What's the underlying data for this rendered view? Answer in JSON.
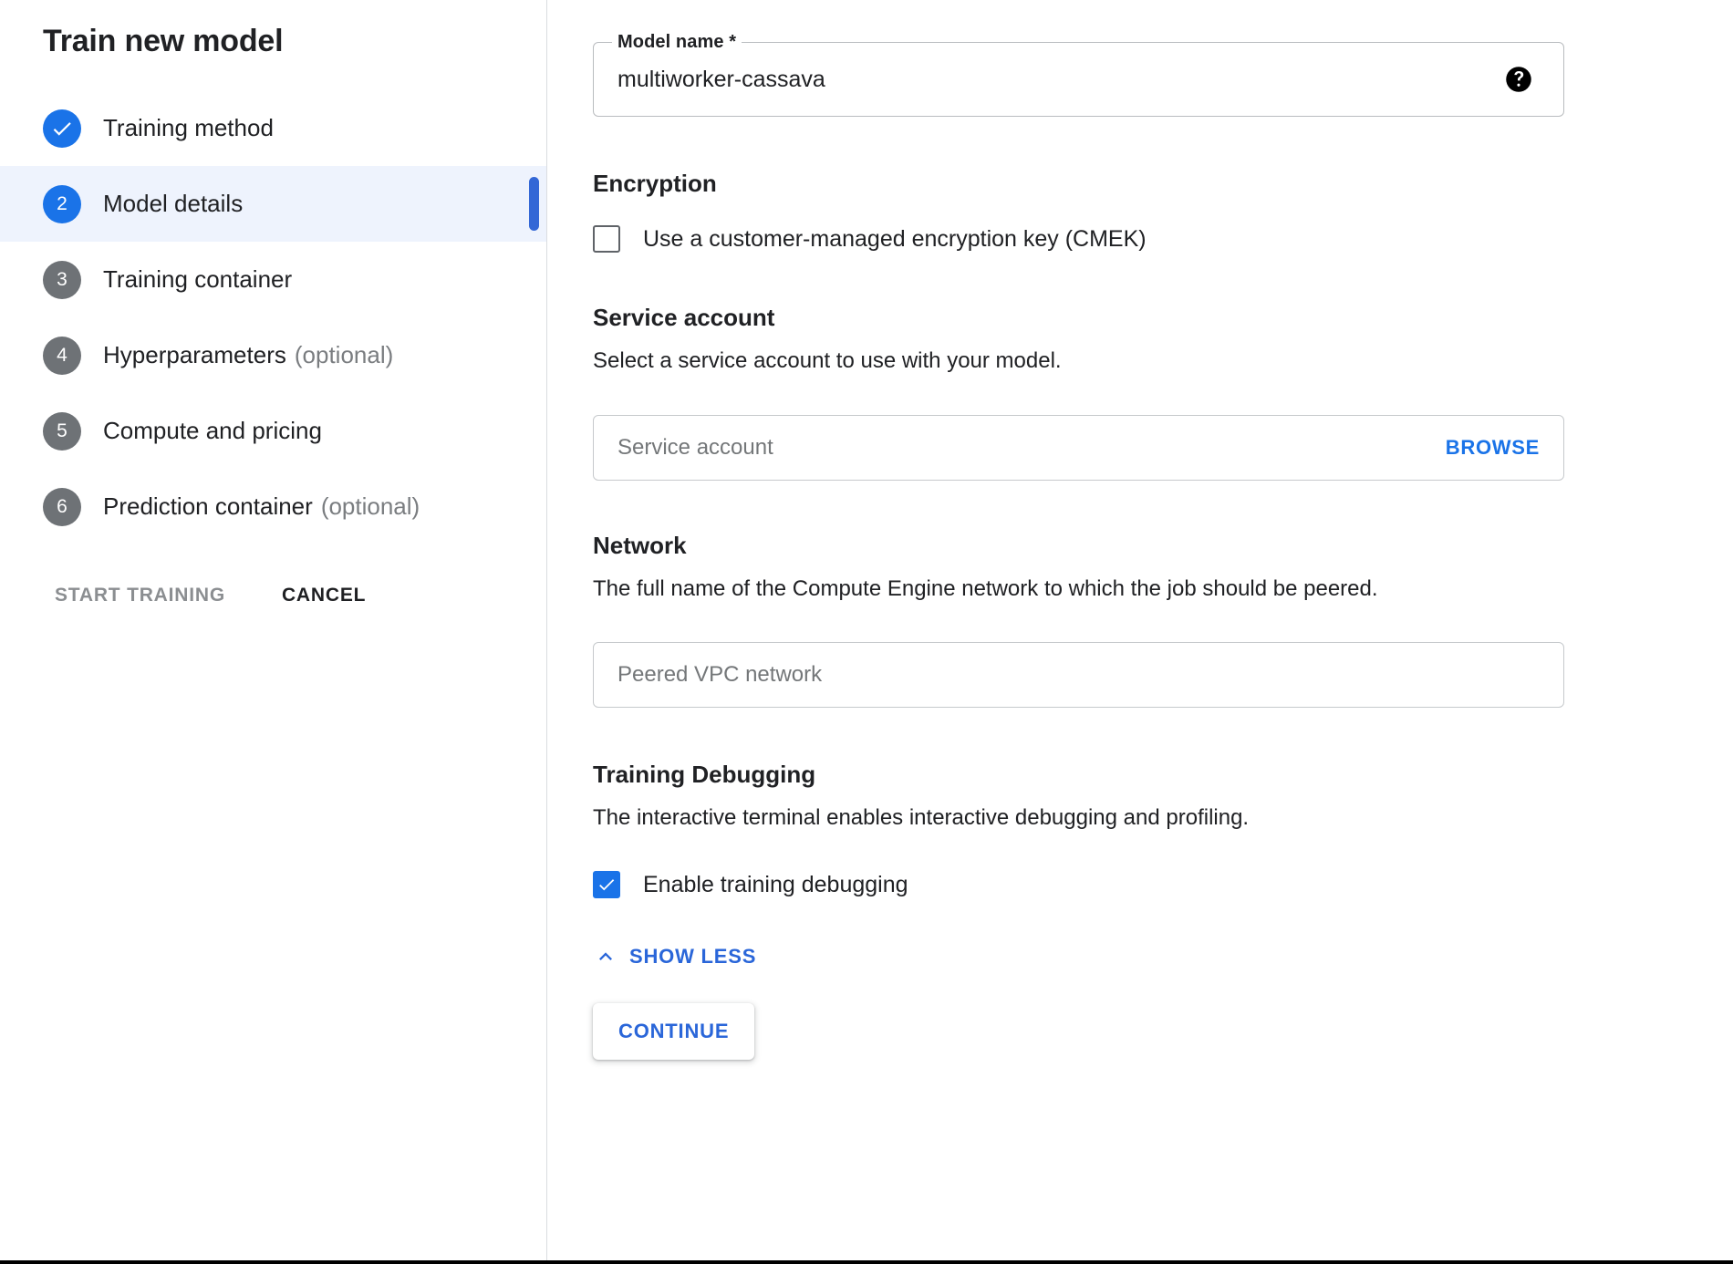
{
  "sidebar": {
    "title": "Train new model",
    "steps": [
      {
        "num": "1",
        "label": "Training method",
        "optional": "",
        "state": "done"
      },
      {
        "num": "2",
        "label": "Model details",
        "optional": "",
        "state": "current"
      },
      {
        "num": "3",
        "label": "Training container",
        "optional": "",
        "state": "pending"
      },
      {
        "num": "4",
        "label": "Hyperparameters",
        "optional": "(optional)",
        "state": "pending"
      },
      {
        "num": "5",
        "label": "Compute and pricing",
        "optional": "",
        "state": "pending"
      },
      {
        "num": "6",
        "label": "Prediction container",
        "optional": "(optional)",
        "state": "pending"
      }
    ],
    "start_training_label": "START TRAINING",
    "cancel_label": "CANCEL"
  },
  "main": {
    "model_name": {
      "label": "Model name *",
      "value": "multiworker-cassava",
      "help_icon": "help-circle-icon"
    },
    "encryption": {
      "title": "Encryption",
      "cmek_label": "Use a customer-managed encryption key (CMEK)",
      "cmek_checked": false
    },
    "service_account": {
      "title": "Service account",
      "description": "Select a service account to use with your model.",
      "placeholder": "Service account",
      "value": "",
      "browse_label": "BROWSE"
    },
    "network": {
      "title": "Network",
      "description": "The full name of the Compute Engine network to which the job should be peered.",
      "placeholder": "Peered VPC network",
      "value": ""
    },
    "training_debugging": {
      "title": "Training Debugging",
      "description": "The interactive terminal enables interactive debugging and profiling.",
      "enable_label": "Enable training debugging",
      "enable_checked": true
    },
    "show_less_label": "SHOW LESS",
    "show_less_icon": "chevron-up-icon",
    "continue_label": "CONTINUE"
  },
  "colors": {
    "accent_blue": "#1a73e8",
    "link_blue": "#2a66d9",
    "active_row_bg": "#eef3fd",
    "step_grey": "#6e7276"
  }
}
